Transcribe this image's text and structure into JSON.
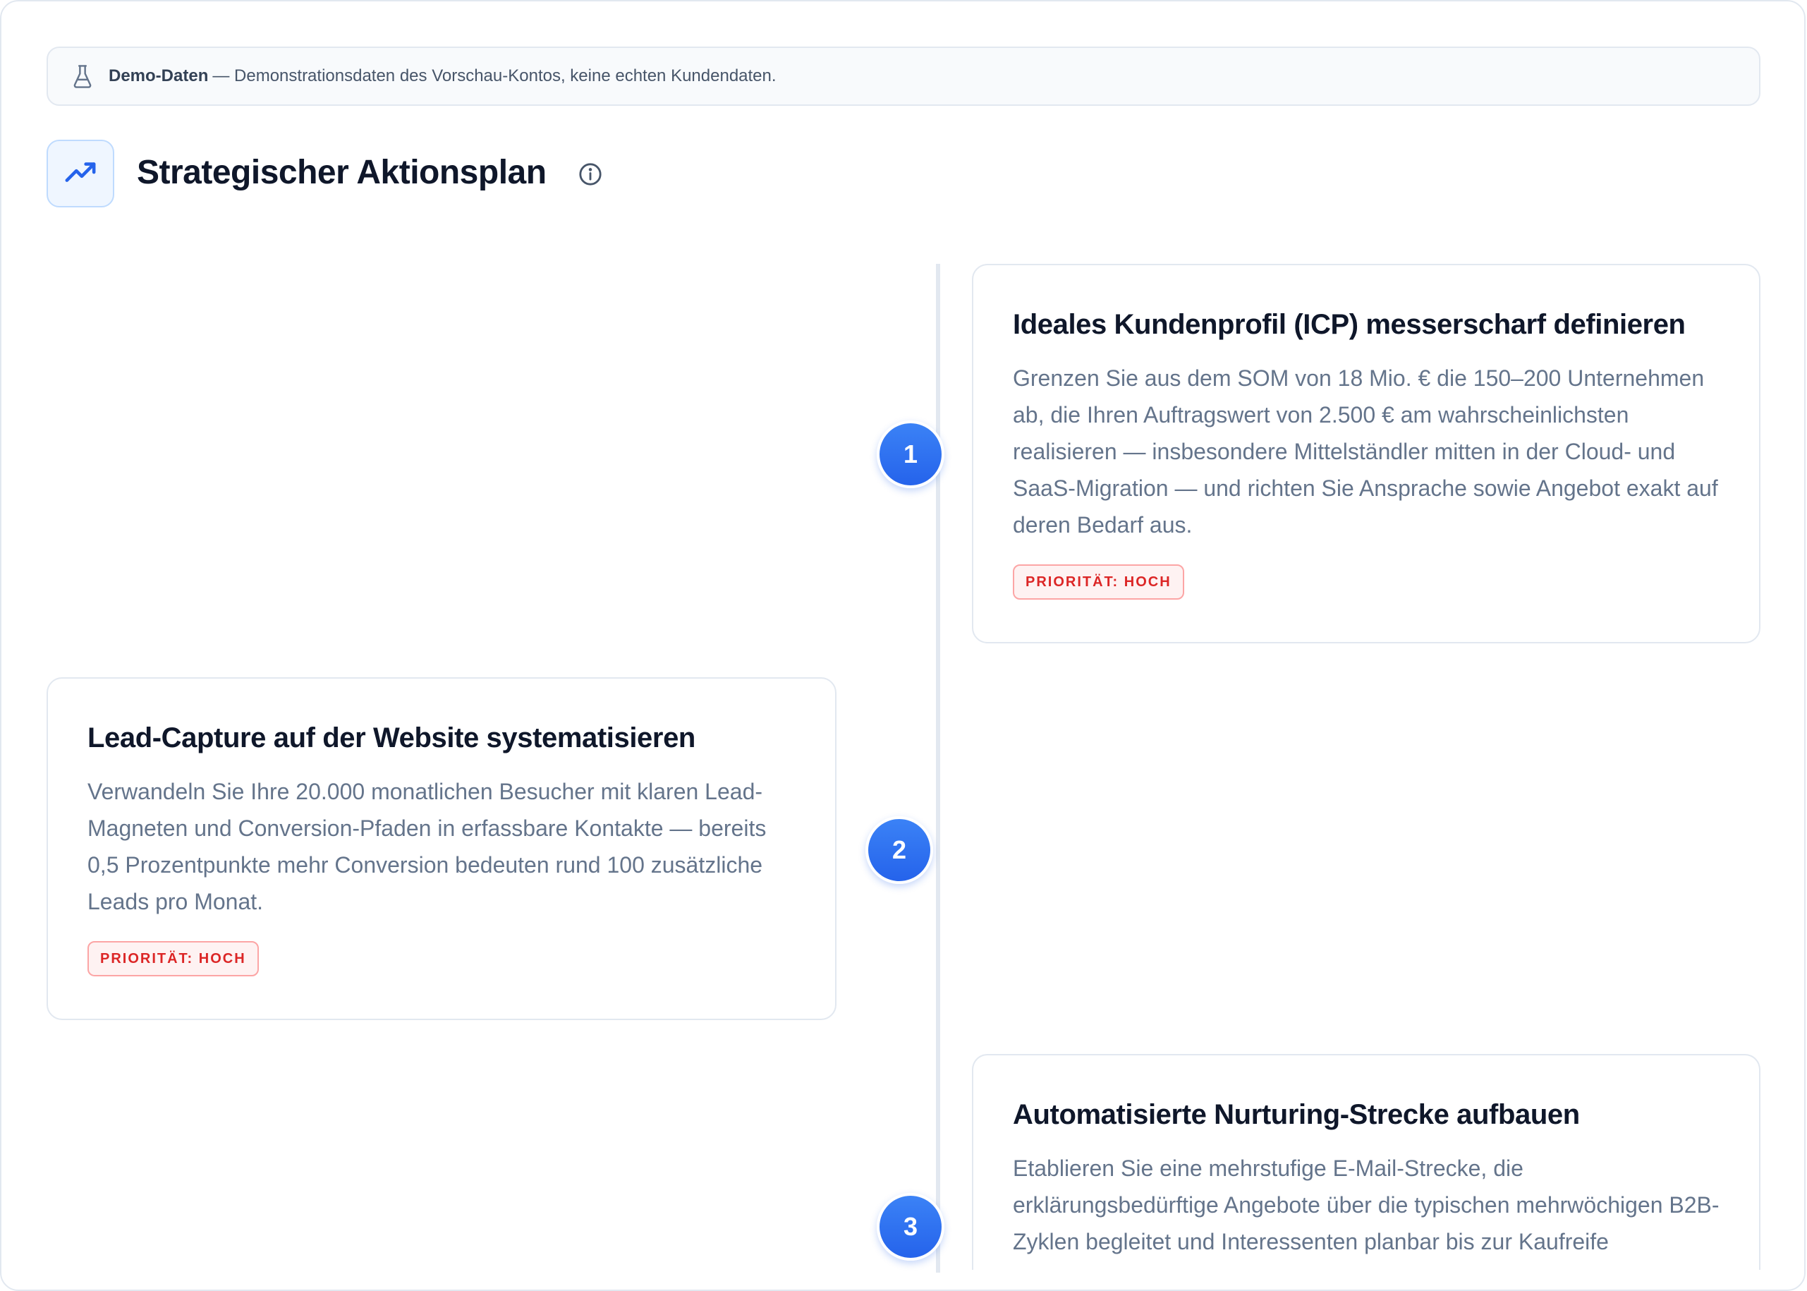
{
  "banner": {
    "icon": "flask-icon",
    "label": "Demo-Daten",
    "text": "— Demonstrationsdaten des Vorschau-Kontos, keine echten Kundendaten."
  },
  "header": {
    "icon": "trending-up-icon",
    "title": "Strategischer Aktionsplan",
    "info_icon": "info-icon"
  },
  "colors": {
    "accent": "#2563eb",
    "priority_text": "#dc2626",
    "priority_bg": "#fef2f2"
  },
  "steps": [
    {
      "number": "1",
      "title": "Ideales Kundenprofil (ICP) messerscharf definieren",
      "text": "Grenzen Sie aus dem SOM von 18 Mio. € die 150–200 Unternehmen ab, die Ihren Auftragswert von 2.500 € am wahrscheinlichsten realisieren — insbesondere Mittelständler mitten in der Cloud- und SaaS-Migration — und richten Sie Ansprache sowie Angebot exakt auf deren Bedarf aus.",
      "priority": "PRIORITÄT: HOCH"
    },
    {
      "number": "2",
      "title": "Lead-Capture auf der Website systematisieren",
      "text": "Verwandeln Sie Ihre 20.000 monatlichen Besucher mit klaren Lead-Magneten und Conversion-Pfaden in erfassbare Kontakte — bereits 0,5 Prozentpunkte mehr Conversion bedeuten rund 100 zusätzliche Leads pro Monat.",
      "priority": "PRIORITÄT: HOCH"
    },
    {
      "number": "3",
      "title": "Automatisierte Nurturing-Strecke aufbauen",
      "text": "Etablieren Sie eine mehrstufige E-Mail-Strecke, die erklärungsbedürftige Angebote über die typischen mehrwöchigen B2B-Zyklen begleitet und Interessenten planbar bis zur Kaufreife"
    }
  ]
}
